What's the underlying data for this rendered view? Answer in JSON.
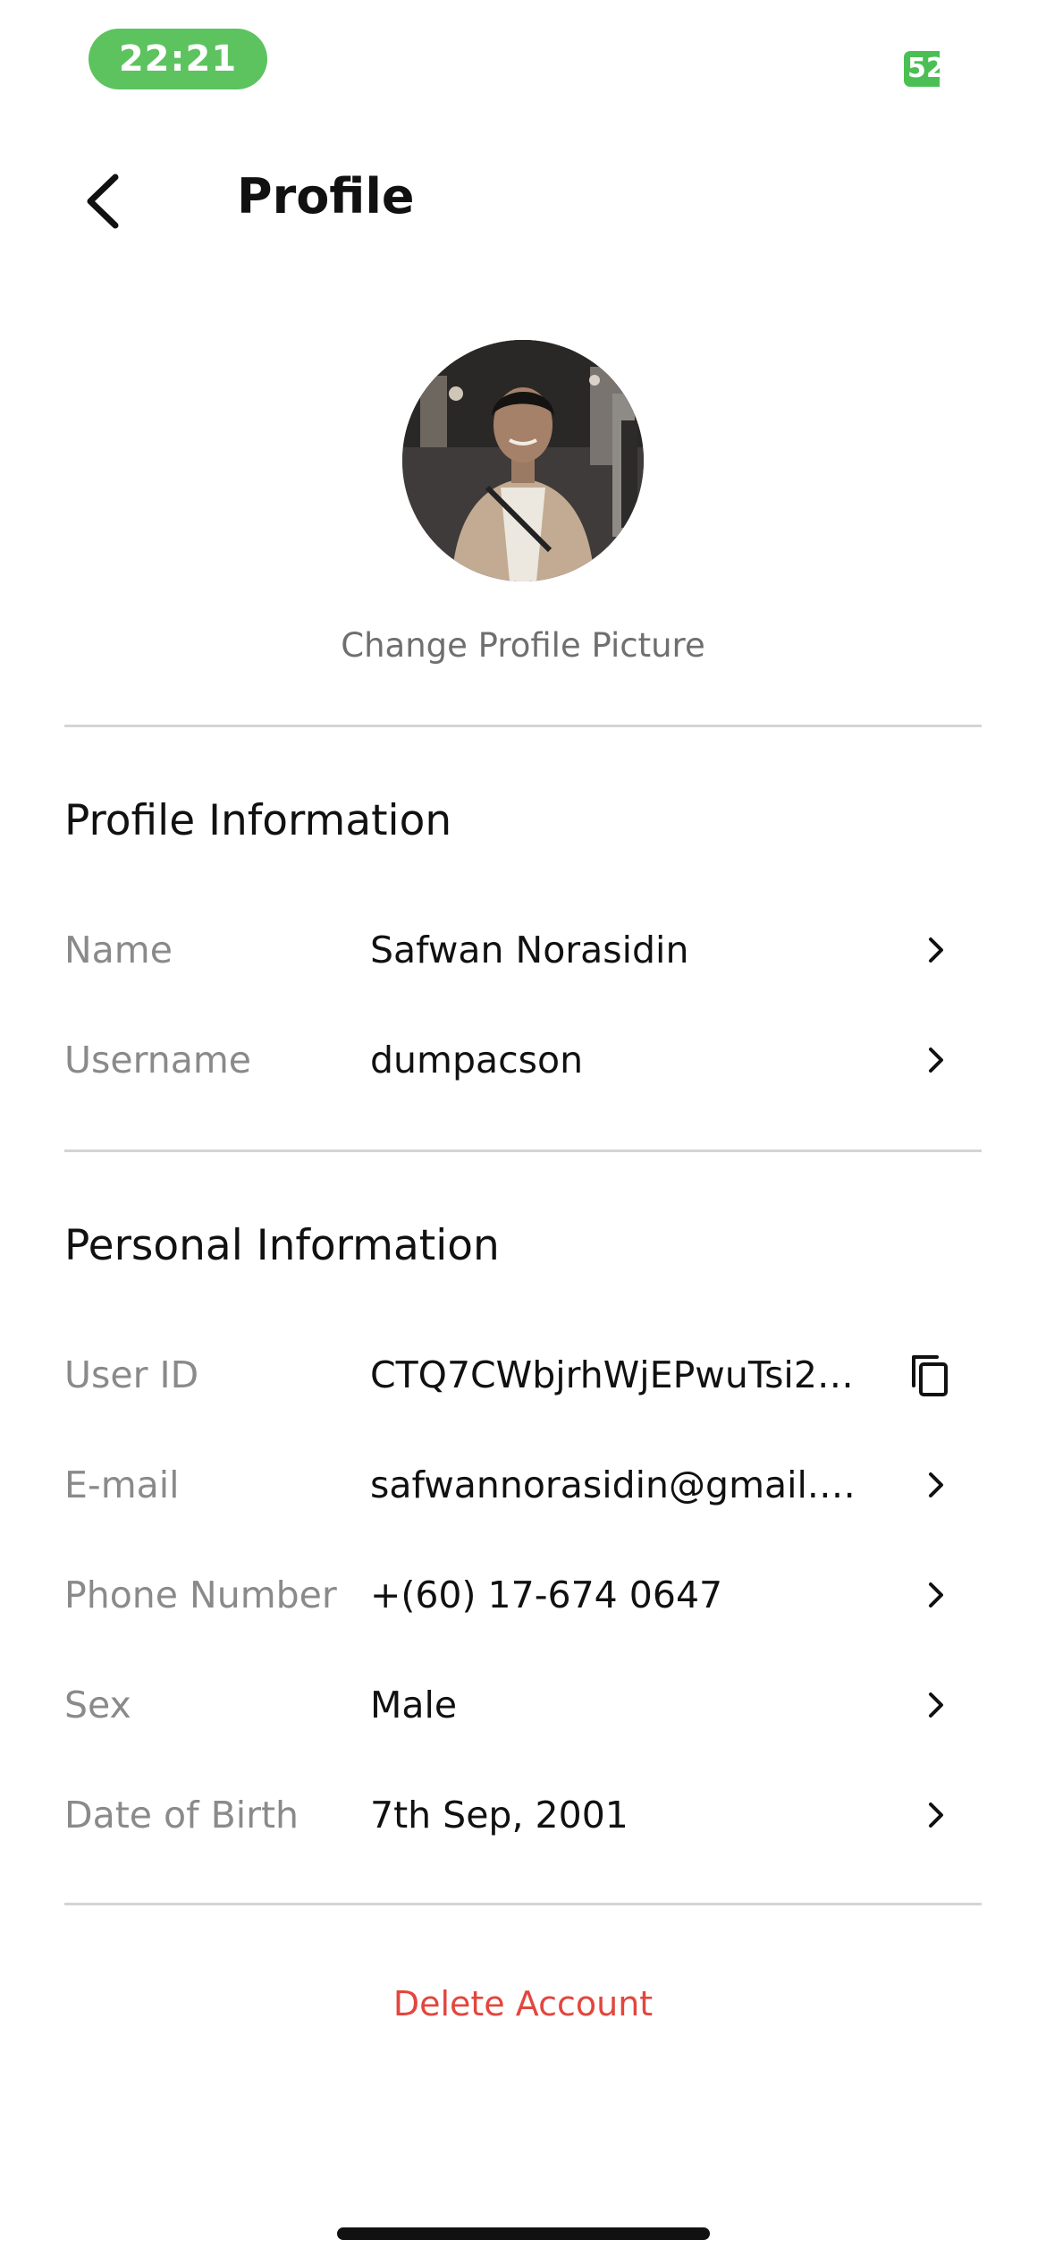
{
  "status_bar": {
    "time": "22:21",
    "battery": "52"
  },
  "header": {
    "title": "Profile",
    "back_icon": "chevron-left-icon"
  },
  "profile": {
    "change_picture_label": "Change Profile Picture"
  },
  "profile_info": {
    "title": "Profile Information",
    "rows": [
      {
        "label": "Name",
        "value": "Safwan Norasidin"
      },
      {
        "label": "Username",
        "value": "dumpacson"
      }
    ]
  },
  "personal_info": {
    "title": "Personal Information",
    "rows": [
      {
        "label": "User ID",
        "value": "CTQ7CWbjrhWjEPwuTsi2…",
        "action": "copy-icon"
      },
      {
        "label": "E-mail",
        "value": "safwannorasidin@gmail.…",
        "action": "chevron-right-icon"
      },
      {
        "label": "Phone Number",
        "value": "+(60) 17-674 0647",
        "action": "chevron-right-icon"
      },
      {
        "label": "Sex",
        "value": "Male",
        "action": "chevron-right-icon"
      },
      {
        "label": "Date of Birth",
        "value": "7th Sep, 2001",
        "action": "chevron-right-icon"
      }
    ]
  },
  "delete_label": "Delete Account",
  "colors": {
    "accent_green": "#5cc35f",
    "danger": "#e2463d",
    "label_gray": "#8a8a8a"
  }
}
